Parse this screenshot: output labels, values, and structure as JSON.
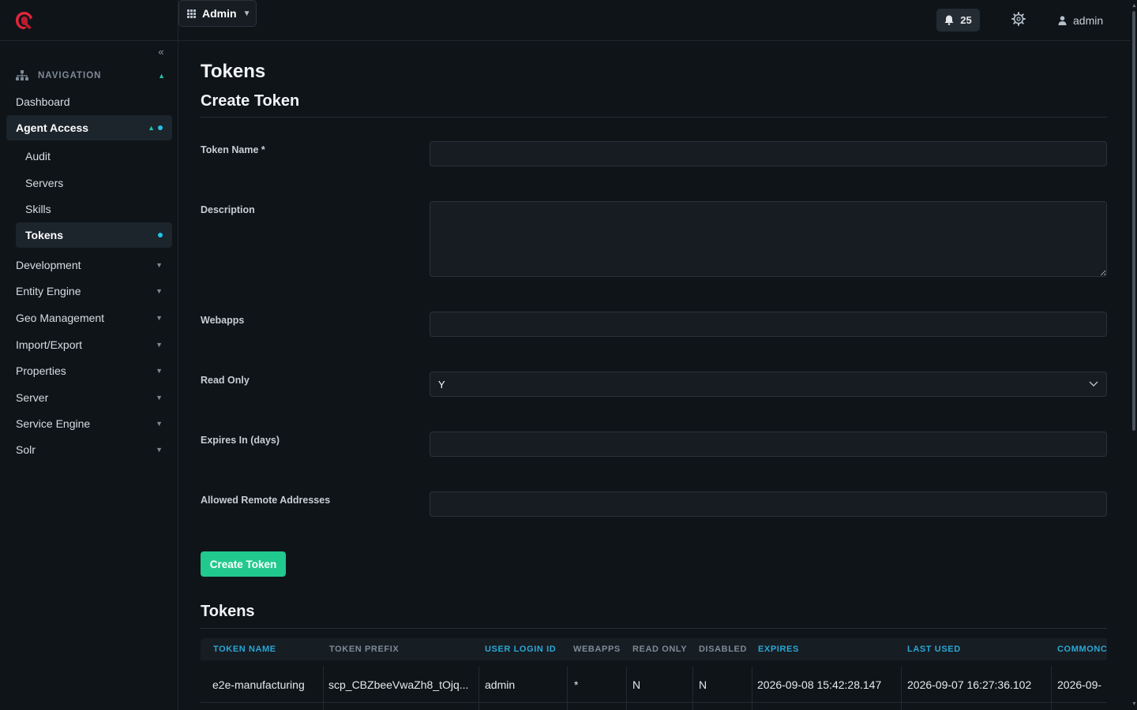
{
  "topbar": {
    "app_switch_label": "Admin",
    "notifications_count": "25",
    "user_name": "admin"
  },
  "sidebar": {
    "nav_header": "NAVIGATION",
    "items": [
      {
        "label": "Dashboard"
      },
      {
        "label": "Agent Access"
      },
      {
        "label": "Audit"
      },
      {
        "label": "Servers"
      },
      {
        "label": "Skills"
      },
      {
        "label": "Tokens"
      },
      {
        "label": "Development"
      },
      {
        "label": "Entity Engine"
      },
      {
        "label": "Geo Management"
      },
      {
        "label": "Import/Export"
      },
      {
        "label": "Properties"
      },
      {
        "label": "Server"
      },
      {
        "label": "Service Engine"
      },
      {
        "label": "Solr"
      }
    ]
  },
  "page": {
    "title": "Tokens",
    "form_title": "Create Token",
    "fields": {
      "token_name": {
        "label": "Token Name *",
        "value": ""
      },
      "description": {
        "label": "Description",
        "value": ""
      },
      "webapps": {
        "label": "Webapps",
        "value": ""
      },
      "read_only": {
        "label": "Read Only",
        "value": "Y"
      },
      "expires_in": {
        "label": "Expires In (days)",
        "value": ""
      },
      "allowed_remote": {
        "label": "Allowed Remote Addresses",
        "value": ""
      }
    },
    "create_button": "Create Token",
    "table_title": "Tokens",
    "table": {
      "columns": [
        "TOKEN NAME",
        "TOKEN PREFIX",
        "USER LOGIN ID",
        "WEBAPPS",
        "READ ONLY",
        "DISABLED",
        "EXPIRES",
        "LAST USED",
        "COMMONC"
      ],
      "rows": [
        [
          "e2e-manufacturing",
          "scp_CBZbeeVwaZh8_tOjq...",
          "admin",
          "*",
          "N",
          "N",
          "2026-09-08 15:42:28.147",
          "2026-09-07 16:27:36.102",
          "2026-09-"
        ]
      ]
    }
  },
  "colors": {
    "accent": "#22c98f",
    "link": "#2aa7d6",
    "active_dot": "#22c3e6",
    "brand_logo": "#e0263a"
  }
}
